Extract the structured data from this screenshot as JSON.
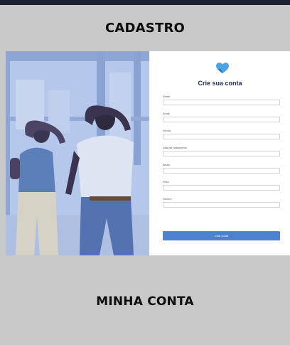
{
  "header": {
    "title": "CADASTRO"
  },
  "form": {
    "title": "Crie sua conta",
    "fields": [
      {
        "label": "Nome",
        "value": ""
      },
      {
        "label": "Email",
        "value": ""
      },
      {
        "label": "Senha",
        "value": ""
      },
      {
        "label": "Data de nascimento",
        "value": ""
      },
      {
        "label": "Altura",
        "value": ""
      },
      {
        "label": "Peso",
        "value": ""
      },
      {
        "label": "Gênero",
        "value": ""
      }
    ],
    "submit_label": "Criar conta"
  },
  "footer": {
    "title": "MINHA CONTA"
  },
  "colors": {
    "accent": "#4d82d3",
    "heading": "#1e2a55",
    "background": "#c8c8c8",
    "topbar": "#1d2232"
  }
}
